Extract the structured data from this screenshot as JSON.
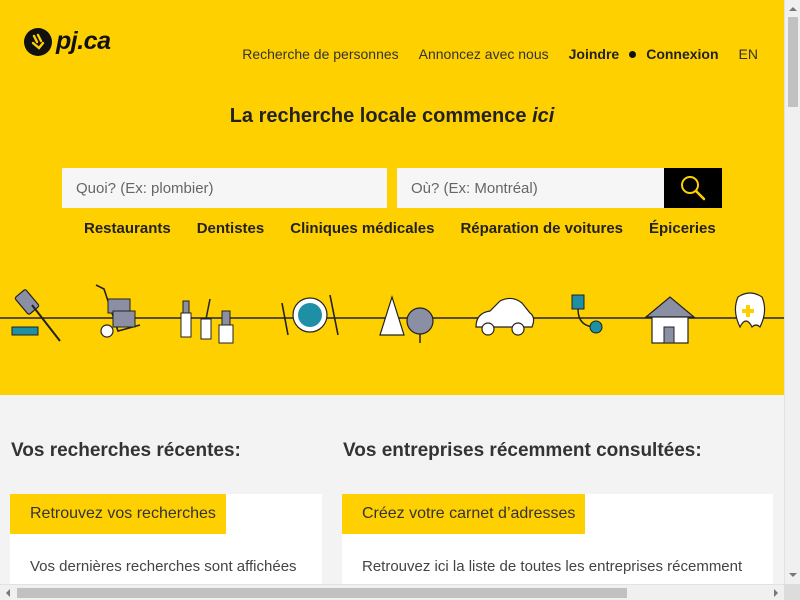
{
  "logo": {
    "text": "pj.ca",
    "icon": "walking-fingers-icon"
  },
  "nav": {
    "people_search": "Recherche de personnes",
    "advertise": "Annoncez avec nous",
    "join": "Joindre",
    "login": "Connexion",
    "lang": "EN"
  },
  "headline": {
    "text": "La recherche locale commence ",
    "emph": "ici"
  },
  "search": {
    "what_placeholder": "Quoi? (Ex: plombier)",
    "where_placeholder": "Où? (Ex: Montréal)",
    "button_icon": "search-icon"
  },
  "categories": [
    "Restaurants",
    "Dentistes",
    "Cliniques médicales",
    "Réparation de voitures",
    "Épiceries"
  ],
  "illustrations": [
    "gavel-icon",
    "hand-truck-icon",
    "cosmetics-icon",
    "plate-cutlery-icon",
    "trees-icon",
    "car-icon",
    "plug-icon",
    "house-icon",
    "tooth-icon"
  ],
  "recent_searches": {
    "heading": "Vos recherches récentes:",
    "tab": "Retrouvez vos recherches",
    "body": "Vos dernières recherches sont affichées"
  },
  "recent_businesses": {
    "heading": "Vos entreprises récemment consultées:",
    "tab": "Créez votre carnet d’adresses",
    "body": "Retrouvez ici la liste de toutes les entreprises récemment"
  },
  "colors": {
    "brand_yellow": "#ffd000",
    "dark": "#111111",
    "accent_teal": "#1f8fa6"
  }
}
